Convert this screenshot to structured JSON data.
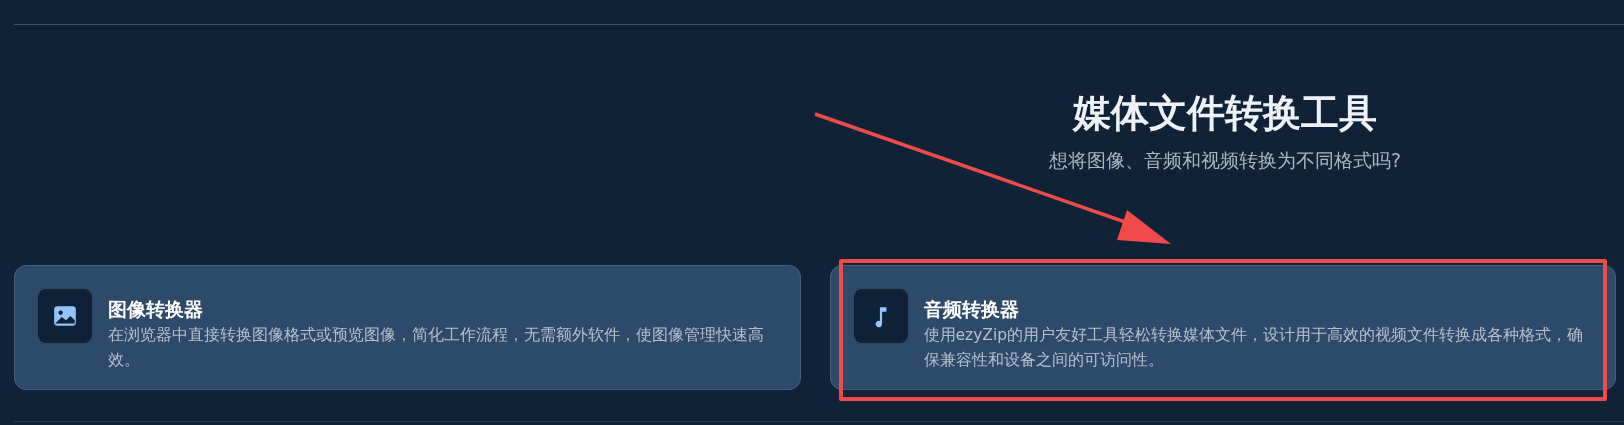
{
  "header": {
    "title": "媒体文件转换工具",
    "subtitle": "想将图像、音频和视频转换为不同格式吗?"
  },
  "cards": [
    {
      "kind": "image",
      "title": "图像转换器",
      "description": "在浏览器中直接转换图像格式或预览图像，简化工作流程，无需额外软件，使图像管理快速高效。"
    },
    {
      "kind": "music",
      "title": "音频转换器",
      "description": "使用ezyZip的用户友好工具轻松转换媒体文件，设计用于高效的视频文件转换成各种格式，确保兼容性和设备之间的可访问性。"
    }
  ]
}
